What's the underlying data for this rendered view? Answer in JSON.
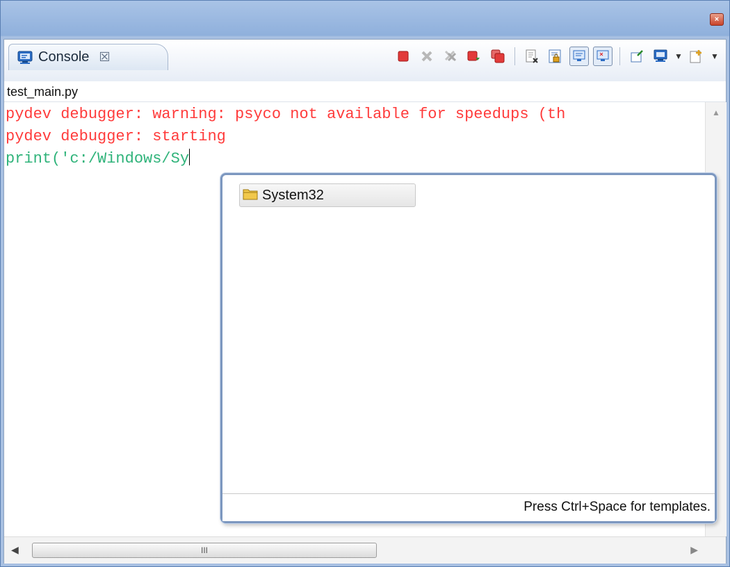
{
  "window": {
    "close_glyph": "×"
  },
  "view": {
    "tab": {
      "label": "Console",
      "close_glyph": "☒"
    },
    "breadcrumb": "test_main.py",
    "toolbar": [
      {
        "name": "terminate-icon",
        "type": "button"
      },
      {
        "name": "remove-launch-icon",
        "type": "button"
      },
      {
        "name": "remove-all-terminated-icon",
        "type": "button"
      },
      {
        "name": "terminate-relaunch-icon",
        "type": "button"
      },
      {
        "name": "terminate-all-icon",
        "type": "button"
      },
      {
        "name": "clear-console-icon",
        "type": "button"
      },
      {
        "name": "scroll-lock-icon",
        "type": "button"
      },
      {
        "name": "show-on-stdout-icon",
        "type": "toggle",
        "pressed": true
      },
      {
        "name": "show-on-stderr-icon",
        "type": "toggle",
        "pressed": true
      },
      {
        "name": "pin-console-icon",
        "type": "button"
      },
      {
        "name": "display-console-icon",
        "type": "dropdown"
      },
      {
        "name": "open-console-icon",
        "type": "dropdown"
      }
    ]
  },
  "console": {
    "lines": [
      {
        "kind": "error",
        "text": "pydev debugger: warning: psyco not available for speedups (th"
      },
      {
        "kind": "error",
        "text": "pydev debugger: starting"
      },
      {
        "kind": "input",
        "text": "print('c:/Windows/Sy"
      }
    ]
  },
  "completion": {
    "items": [
      {
        "label": "System32",
        "icon": "folder-icon"
      }
    ],
    "footer": "Press Ctrl+Space for templates."
  },
  "hscroll": {
    "grip_glyph": "III"
  },
  "colors": {
    "error_text": "#ff3b3b",
    "input_text": "#2fb37a",
    "title_bar": "#8fb0dc",
    "close_button": "#c9432a"
  }
}
